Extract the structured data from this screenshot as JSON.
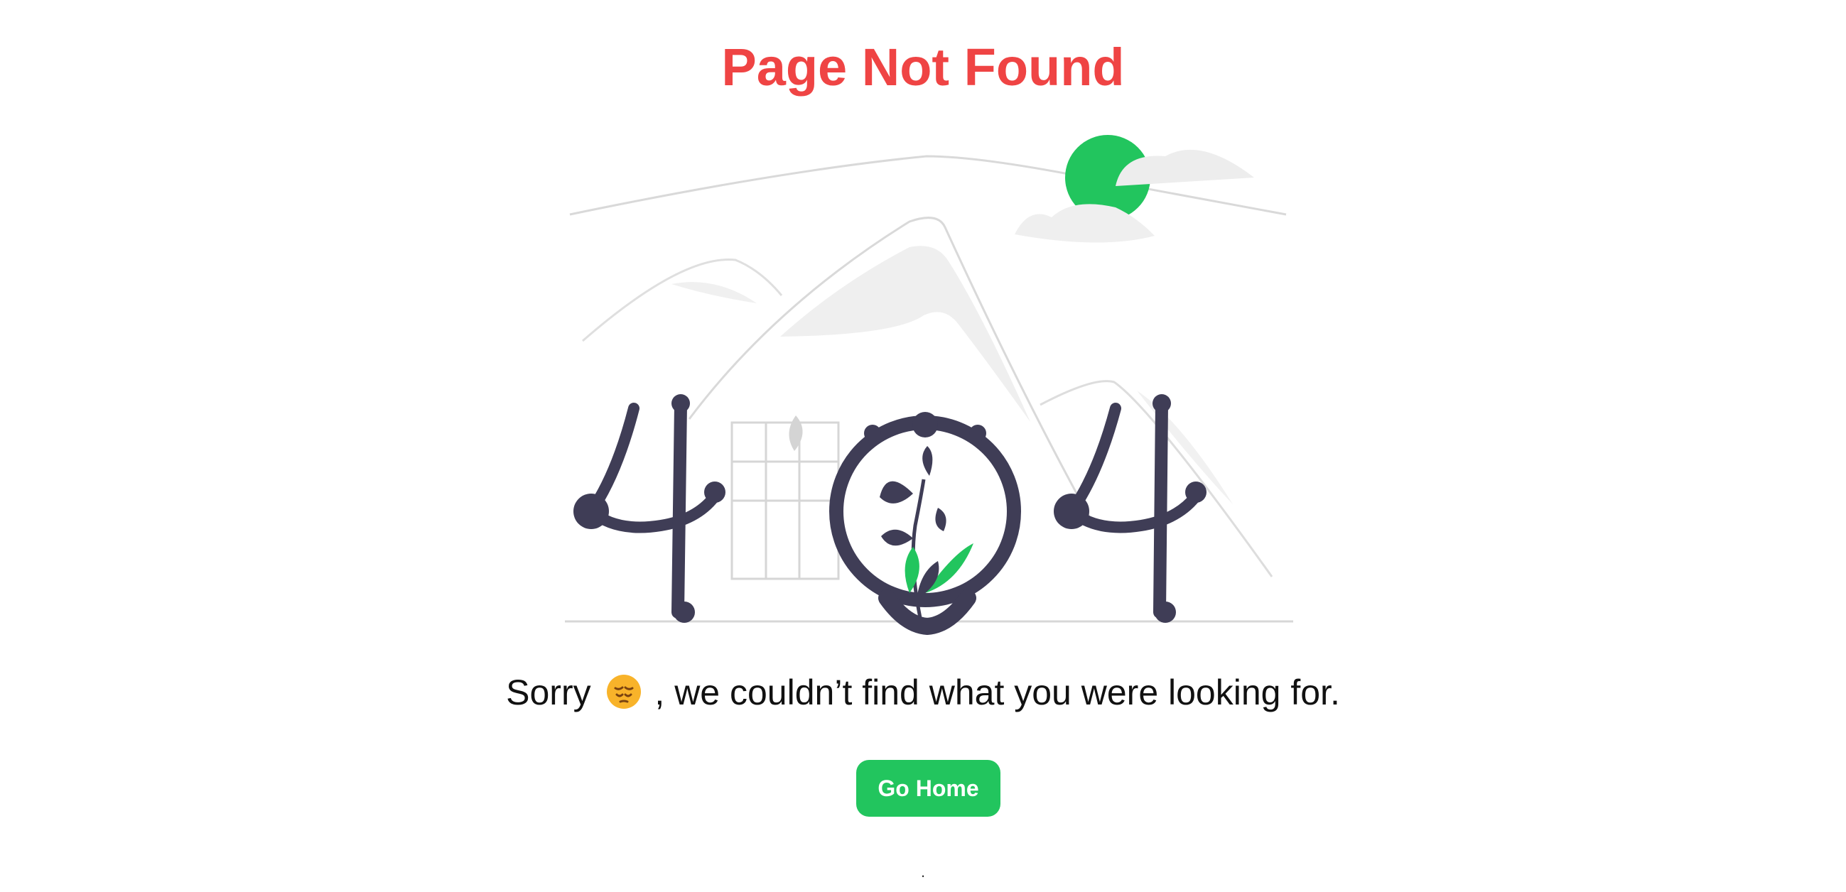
{
  "page": {
    "title": "Page Not Found",
    "message_before": "Sorry ",
    "message_after": ", we couldn’t find what you were looking for.",
    "button_label": "Go Home",
    "footer_mark": "."
  },
  "illustration": {
    "name": "404-plant-in-mountains",
    "colors": {
      "accent": "#22c55e",
      "dark": "#3f3d56",
      "line": "#d9d9d9",
      "fill": "#f0f0f0",
      "title": "#ef4444"
    },
    "emoji": "pensive-face-icon"
  }
}
